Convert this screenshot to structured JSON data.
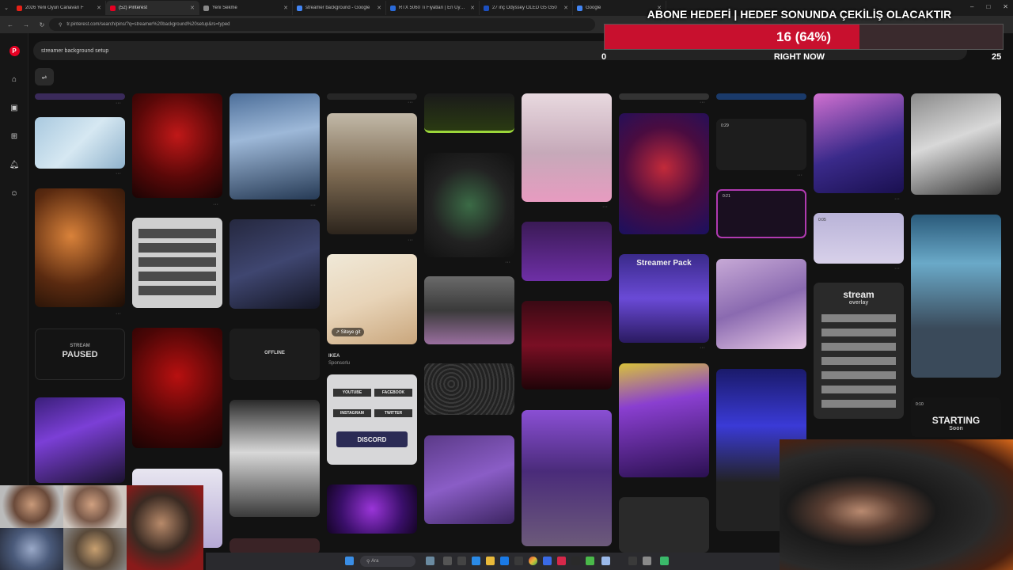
{
  "browser": {
    "tabs": [
      {
        "title": "2026 Yeni Oyun Canavarı F",
        "color": "#e62117",
        "active": false
      },
      {
        "title": "(52) Pinterest",
        "color": "#e60023",
        "active": true
      },
      {
        "title": "Yeni Sekme",
        "color": "#888888",
        "active": false
      },
      {
        "title": "streamer background - Google",
        "color": "#4285f4",
        "active": false
      },
      {
        "title": "RTX 5060 Ti Fiyatları | En Uygun",
        "color": "#2a6ad8",
        "active": false
      },
      {
        "title": "27 inç Odyssey OLED G5 G50",
        "color": "#1c4fbf",
        "active": false
      },
      {
        "title": "Google",
        "color": "#4285f4",
        "active": false
      }
    ],
    "url": "tr.pinterest.com/search/pins/?q=streamer%20background%20setup&rs=typed",
    "window_controls": [
      "–",
      "□",
      "✕"
    ]
  },
  "pinterest": {
    "search_value": "streamer background setup",
    "sidebar_icons": [
      "pinterest-logo",
      "home-icon",
      "explore-icon",
      "create-icon",
      "notifications-icon",
      "messages-icon"
    ],
    "pins": {
      "paused_label": "PAUSED",
      "stream_label": "STREAM",
      "offline_label": "OFFLINE",
      "visit_site": "↗ Siteye git",
      "ikea_name": "IKEA",
      "ikea_sponsored": "Sponsorlu",
      "streamer_pack": "Streamer Pack",
      "stream_overlay": "stream",
      "overlay_sub": "overlay",
      "starting": "STARTING",
      "starting_sub": "Soon",
      "discord": "DISCORD",
      "youtube": "YOUTUBE",
      "facebook": "FACEBOOK",
      "instagram": "INSTAGRAM",
      "twitter": "TWITTER",
      "duration_1": "0:29",
      "duration_2": "0:05",
      "duration_3": "0:10",
      "duration_4": "0:21"
    }
  },
  "overlay": {
    "goal_title": "ABONE HEDEFİ | HEDEF SONUNDA ÇEKİLİŞ OLACAKTIR",
    "goal_text": "16 (64%)",
    "goal_progress": 0.64,
    "goal_min": "0",
    "goal_max": "25",
    "goal_caption": "RIGHT NOW",
    "bar_color": "#c8102e"
  },
  "taskbar": {
    "search_placeholder": "Ara"
  }
}
